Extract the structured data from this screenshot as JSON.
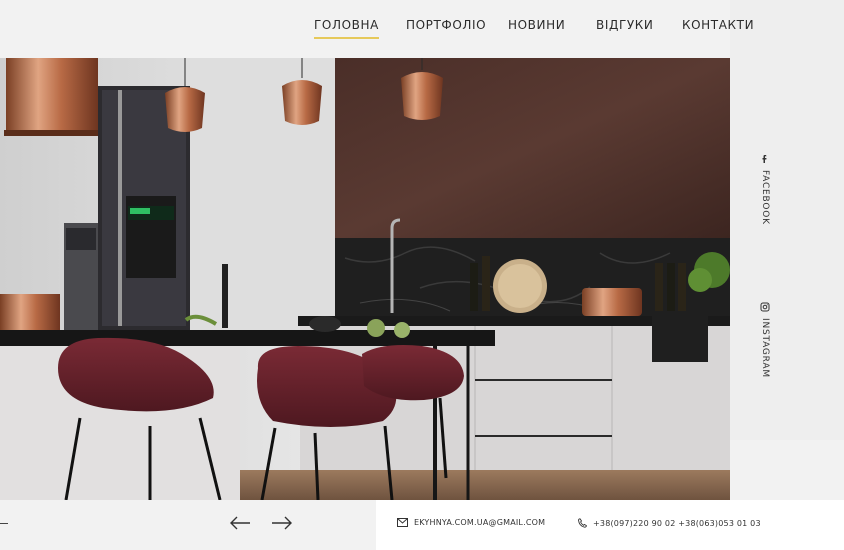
{
  "nav": {
    "items": [
      {
        "label": "ГОЛОВНА",
        "active": true
      },
      {
        "label": "ПОРТФОЛІО",
        "active": false
      },
      {
        "label": "НОВИНИ",
        "active": false
      },
      {
        "label": "ВІДГУКИ",
        "active": false
      },
      {
        "label": "КОНТАКТИ",
        "active": false
      }
    ],
    "accent_color": "#e6c95a"
  },
  "social": {
    "facebook": {
      "label": "FACEBOOK",
      "icon": "facebook-icon"
    },
    "instagram": {
      "label": "INSTAGRAM",
      "icon": "instagram-icon"
    }
  },
  "footer": {
    "email": "EKYHNYA.COM.UA@GMAIL.COM",
    "phones": "+38(097)220 90 02  +38(063)053 01 03",
    "email_icon": "mail-icon",
    "phone_icon": "phone-icon",
    "prev_icon": "arrow-left-icon",
    "next_icon": "arrow-right-icon"
  },
  "hero": {
    "subject": "kitchen-interior-photo"
  }
}
